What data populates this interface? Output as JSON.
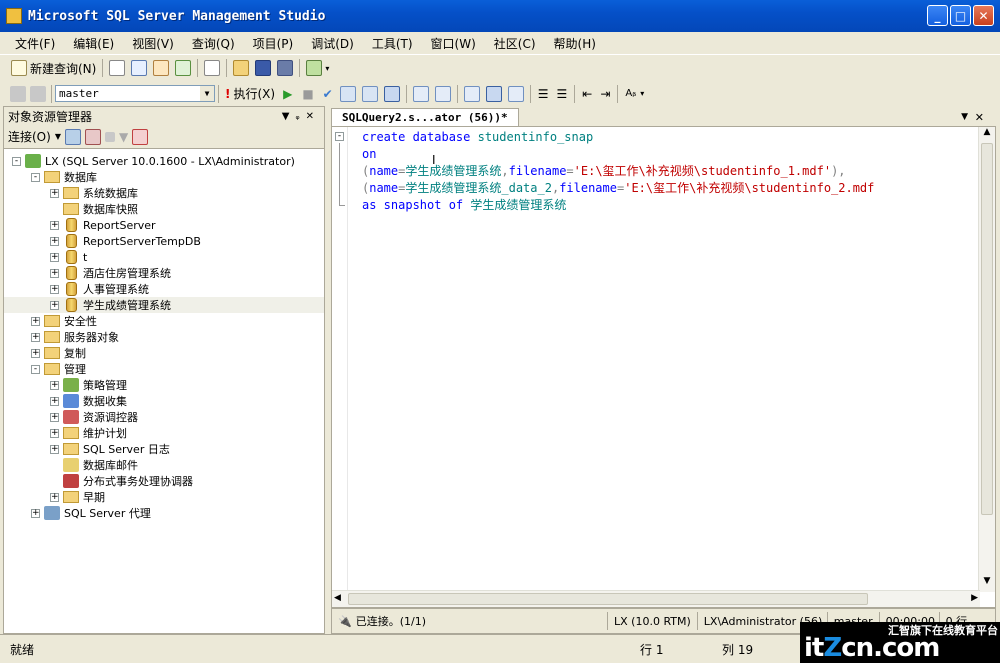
{
  "window": {
    "title": "Microsoft SQL Server Management Studio"
  },
  "menu": [
    "文件(F)",
    "编辑(E)",
    "视图(V)",
    "查询(Q)",
    "项目(P)",
    "调试(D)",
    "工具(T)",
    "窗口(W)",
    "社区(C)",
    "帮助(H)"
  ],
  "toolbar": {
    "new_query": "新建查询(N)",
    "database": "master",
    "execute": "执行(X)"
  },
  "object_explorer": {
    "title": "对象资源管理器",
    "connect": "连接(O)",
    "nodes": [
      {
        "label": "LX (SQL Server 10.0.1600 - LX\\Administrator)",
        "level": 0,
        "exp": "-",
        "icon": "server"
      },
      {
        "label": "数据库",
        "level": 1,
        "exp": "-",
        "icon": "folder"
      },
      {
        "label": "系统数据库",
        "level": 2,
        "exp": "+",
        "icon": "folder"
      },
      {
        "label": "数据库快照",
        "level": 2,
        "exp": "",
        "icon": "folder"
      },
      {
        "label": "ReportServer",
        "level": 2,
        "exp": "+",
        "icon": "db"
      },
      {
        "label": "ReportServerTempDB",
        "level": 2,
        "exp": "+",
        "icon": "db"
      },
      {
        "label": "t",
        "level": 2,
        "exp": "+",
        "icon": "db"
      },
      {
        "label": "酒店住房管理系统",
        "level": 2,
        "exp": "+",
        "icon": "db"
      },
      {
        "label": "人事管理系统",
        "level": 2,
        "exp": "+",
        "icon": "db"
      },
      {
        "label": "学生成绩管理系统",
        "level": 2,
        "exp": "+",
        "icon": "db",
        "selected": true
      },
      {
        "label": "安全性",
        "level": 1,
        "exp": "+",
        "icon": "folder"
      },
      {
        "label": "服务器对象",
        "level": 1,
        "exp": "+",
        "icon": "folder"
      },
      {
        "label": "复制",
        "level": 1,
        "exp": "+",
        "icon": "folder"
      },
      {
        "label": "管理",
        "level": 1,
        "exp": "-",
        "icon": "folder"
      },
      {
        "label": "策略管理",
        "level": 2,
        "exp": "+",
        "icon": "policy"
      },
      {
        "label": "数据收集",
        "level": 2,
        "exp": "+",
        "icon": "chart"
      },
      {
        "label": "资源调控器",
        "level": 2,
        "exp": "+",
        "icon": "resource"
      },
      {
        "label": "维护计划",
        "level": 2,
        "exp": "+",
        "icon": "folder"
      },
      {
        "label": "SQL Server 日志",
        "level": 2,
        "exp": "+",
        "icon": "folder"
      },
      {
        "label": "数据库邮件",
        "level": 2,
        "exp": "",
        "icon": "mail"
      },
      {
        "label": "分布式事务处理协调器",
        "level": 2,
        "exp": "",
        "icon": "dtc"
      },
      {
        "label": "早期",
        "level": 2,
        "exp": "+",
        "icon": "folder"
      },
      {
        "label": "SQL Server 代理",
        "level": 1,
        "exp": "+",
        "icon": "agent"
      }
    ]
  },
  "editor": {
    "tab": "SQLQuery2.s...ator (56))*",
    "lines": [
      [
        {
          "t": "create database ",
          "c": "kw"
        },
        {
          "t": "studentinfo_snap",
          "c": "id"
        }
      ],
      [
        {
          "t": "on",
          "c": "kw"
        }
      ],
      [
        {
          "t": "(",
          "c": "gr"
        },
        {
          "t": "name",
          "c": "kw"
        },
        {
          "t": "=",
          "c": "gr"
        },
        {
          "t": "学生成绩管理系统",
          "c": "id"
        },
        {
          "t": ",",
          "c": "gr"
        },
        {
          "t": "filename",
          "c": "kw"
        },
        {
          "t": "=",
          "c": "gr"
        },
        {
          "t": "'E:\\玺工作\\补充视频\\studentinfo_1.mdf'",
          "c": "st"
        },
        {
          "t": "),",
          "c": "gr"
        }
      ],
      [
        {
          "t": "(",
          "c": "gr"
        },
        {
          "t": "name",
          "c": "kw"
        },
        {
          "t": "=",
          "c": "gr"
        },
        {
          "t": "学生成绩管理系统_data_2",
          "c": "id"
        },
        {
          "t": ",",
          "c": "gr"
        },
        {
          "t": "filename",
          "c": "kw"
        },
        {
          "t": "=",
          "c": "gr"
        },
        {
          "t": "'E:\\玺工作\\补充视频\\studentinfo_2.mdf",
          "c": "st"
        }
      ],
      [
        {
          "t": "as snapshot of ",
          "c": "kw"
        },
        {
          "t": "学生成绩管理系统",
          "c": "id"
        }
      ]
    ]
  },
  "editor_status": {
    "state": "已连接。(1/1)",
    "server": "LX (10.0 RTM)",
    "user": "LX\\Administrator (56)",
    "db": "master",
    "time": "00:00:00",
    "rows": "0 行"
  },
  "statusbar": {
    "ready": "就绪",
    "line": "行 1",
    "col": "列 19"
  },
  "watermark": {
    "brand_a": "it",
    "brand_b": "Z",
    "brand_c": "cn.com",
    "tagline": "汇智旗下在线教育平台"
  }
}
